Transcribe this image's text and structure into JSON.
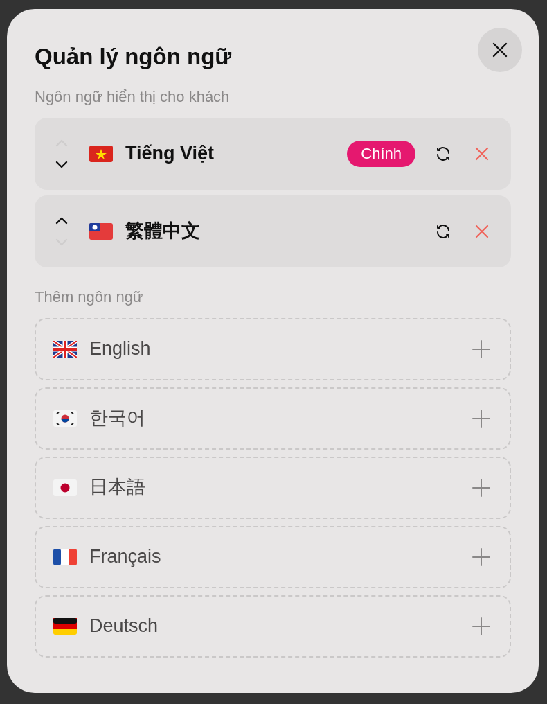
{
  "dialog": {
    "title": "Quản lý ngôn ngữ"
  },
  "displayed": {
    "label": "Ngôn ngữ hiển thị cho khách",
    "languages": [
      {
        "name": "Tiếng Việt",
        "kind": "vn",
        "badge": "Chính",
        "can_move_up": false,
        "can_move_down": true
      },
      {
        "name": "繁體中文",
        "kind": "tw",
        "can_move_up": true,
        "can_move_down": false
      }
    ]
  },
  "add": {
    "label": "Thêm ngôn ngữ",
    "languages": [
      {
        "name": "English",
        "kind": "gb"
      },
      {
        "name": "한국어",
        "kind": "kr"
      },
      {
        "name": "日本語",
        "kind": "jp"
      },
      {
        "name": "Français",
        "kind": "fr"
      },
      {
        "name": "Deutsch",
        "kind": "de"
      }
    ]
  }
}
